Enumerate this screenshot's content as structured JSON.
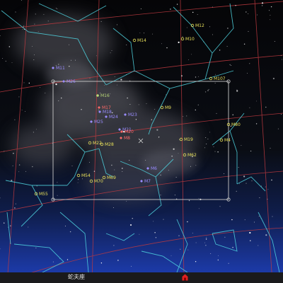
{
  "status": {
    "constellation": "蛇夫座"
  },
  "colors": {
    "const_line": "#4fd4e0",
    "grid": "#c03a40",
    "frame": "#c8c8c8",
    "globular": "#e8e05a",
    "open": "#b8d878",
    "nebula": "#9a8cff",
    "nebula_hot": "#ff6a6a"
  },
  "icons": {
    "center": "crosshair-icon",
    "marker": "red-house-icon",
    "frame_corner": "frame-handle-icon"
  },
  "objects": [
    {
      "label": "M12",
      "kind": "globular"
    },
    {
      "label": "M14",
      "kind": "globular"
    },
    {
      "label": "M10",
      "kind": "globular"
    },
    {
      "label": "M11",
      "kind": "nebula"
    },
    {
      "label": "M26",
      "kind": "nebula"
    },
    {
      "label": "M107",
      "kind": "globular"
    },
    {
      "label": "M16",
      "kind": "open"
    },
    {
      "label": "M17",
      "kind": "nebula_hot"
    },
    {
      "label": "M18",
      "kind": "nebula"
    },
    {
      "label": "M24",
      "kind": "nebula"
    },
    {
      "label": "M23",
      "kind": "nebula"
    },
    {
      "label": "M9",
      "kind": "globular"
    },
    {
      "label": "M25",
      "kind": "nebula"
    },
    {
      "label": "M21",
      "kind": "nebula"
    },
    {
      "label": "M20",
      "kind": "nebula_hot"
    },
    {
      "label": "M8",
      "kind": "nebula_hot"
    },
    {
      "label": "M80",
      "kind": "globular"
    },
    {
      "label": "M4",
      "kind": "globular"
    },
    {
      "label": "M19",
      "kind": "globular"
    },
    {
      "label": "M22",
      "kind": "globular"
    },
    {
      "label": "M28",
      "kind": "globular"
    },
    {
      "label": "M62",
      "kind": "globular"
    },
    {
      "label": "M6",
      "kind": "nebula"
    },
    {
      "label": "M54",
      "kind": "globular"
    },
    {
      "label": "M69",
      "kind": "globular"
    },
    {
      "label": "M70",
      "kind": "globular"
    },
    {
      "label": "M7",
      "kind": "nebula"
    },
    {
      "label": "M55",
      "kind": "globular"
    }
  ]
}
